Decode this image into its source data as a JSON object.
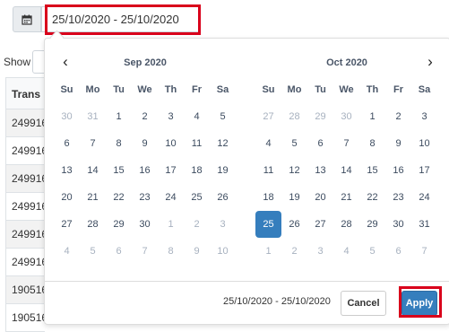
{
  "date_input": {
    "value": "25/10/2020 - 25/10/2020"
  },
  "show_label": "Show",
  "table": {
    "header": "Trans",
    "rows": [
      "249916",
      "249916",
      "249916",
      "249916",
      "249916",
      "249916",
      "190516",
      "190516"
    ]
  },
  "calendars": [
    {
      "month": "Sep 2020",
      "weekdays": [
        "Su",
        "Mo",
        "Tu",
        "We",
        "Th",
        "Fr",
        "Sa"
      ],
      "weeks": [
        [
          {
            "d": "30",
            "off": true
          },
          {
            "d": "31",
            "off": true
          },
          {
            "d": "1"
          },
          {
            "d": "2"
          },
          {
            "d": "3"
          },
          {
            "d": "4"
          },
          {
            "d": "5"
          }
        ],
        [
          {
            "d": "6"
          },
          {
            "d": "7"
          },
          {
            "d": "8"
          },
          {
            "d": "9"
          },
          {
            "d": "10"
          },
          {
            "d": "11"
          },
          {
            "d": "12"
          }
        ],
        [
          {
            "d": "13"
          },
          {
            "d": "14"
          },
          {
            "d": "15"
          },
          {
            "d": "16"
          },
          {
            "d": "17"
          },
          {
            "d": "18"
          },
          {
            "d": "19"
          }
        ],
        [
          {
            "d": "20"
          },
          {
            "d": "21"
          },
          {
            "d": "22"
          },
          {
            "d": "23"
          },
          {
            "d": "24"
          },
          {
            "d": "25"
          },
          {
            "d": "26"
          }
        ],
        [
          {
            "d": "27"
          },
          {
            "d": "28"
          },
          {
            "d": "29"
          },
          {
            "d": "30"
          },
          {
            "d": "1",
            "off": true
          },
          {
            "d": "2",
            "off": true
          },
          {
            "d": "3",
            "off": true
          }
        ],
        [
          {
            "d": "4",
            "off": true
          },
          {
            "d": "5",
            "off": true
          },
          {
            "d": "6",
            "off": true
          },
          {
            "d": "7",
            "off": true
          },
          {
            "d": "8",
            "off": true
          },
          {
            "d": "9",
            "off": true
          },
          {
            "d": "10",
            "off": true
          }
        ]
      ]
    },
    {
      "month": "Oct 2020",
      "weekdays": [
        "Su",
        "Mo",
        "Tu",
        "We",
        "Th",
        "Fr",
        "Sa"
      ],
      "weeks": [
        [
          {
            "d": "27",
            "off": true
          },
          {
            "d": "28",
            "off": true
          },
          {
            "d": "29",
            "off": true
          },
          {
            "d": "30",
            "off": true
          },
          {
            "d": "1"
          },
          {
            "d": "2"
          },
          {
            "d": "3"
          }
        ],
        [
          {
            "d": "4"
          },
          {
            "d": "5"
          },
          {
            "d": "6"
          },
          {
            "d": "7"
          },
          {
            "d": "8"
          },
          {
            "d": "9"
          },
          {
            "d": "10"
          }
        ],
        [
          {
            "d": "11"
          },
          {
            "d": "12"
          },
          {
            "d": "13"
          },
          {
            "d": "14"
          },
          {
            "d": "15"
          },
          {
            "d": "16"
          },
          {
            "d": "17"
          }
        ],
        [
          {
            "d": "18"
          },
          {
            "d": "19"
          },
          {
            "d": "20"
          },
          {
            "d": "21"
          },
          {
            "d": "22"
          },
          {
            "d": "23"
          },
          {
            "d": "24"
          }
        ],
        [
          {
            "d": "25",
            "active": true
          },
          {
            "d": "26"
          },
          {
            "d": "27"
          },
          {
            "d": "28"
          },
          {
            "d": "29"
          },
          {
            "d": "30"
          },
          {
            "d": "31"
          }
        ],
        [
          {
            "d": "1",
            "off": true
          },
          {
            "d": "2",
            "off": true
          },
          {
            "d": "3",
            "off": true
          },
          {
            "d": "4",
            "off": true
          },
          {
            "d": "5",
            "off": true
          },
          {
            "d": "6",
            "off": true
          },
          {
            "d": "7",
            "off": true
          }
        ]
      ]
    }
  ],
  "footer": {
    "selected_range": "25/10/2020 - 25/10/2020",
    "cancel_label": "Cancel",
    "apply_label": "Apply"
  },
  "icons": {
    "calendar": "calendar-icon",
    "prev": "chevron-left-icon",
    "next": "chevron-right-icon"
  },
  "colors": {
    "accent": "#357ebd",
    "highlight": "#d9001b"
  }
}
